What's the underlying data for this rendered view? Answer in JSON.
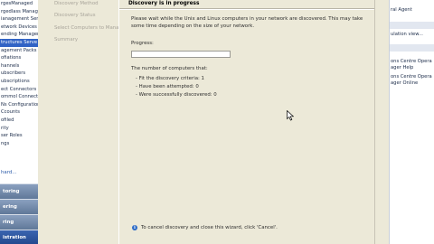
{
  "nav": {
    "items": [
      "rgesManaged",
      "rgedlass Manager",
      "ianagement Ser",
      "etwork Devices",
      "ending Manager",
      "tructures Serve",
      "agement Packs",
      "ofiations",
      "hannels",
      "ubscribers",
      "ubscriptions",
      "ect Connectors",
      "ommol Connect",
      "Ns Configuration",
      "Ccounts",
      "ofiled",
      "rity",
      "ser Roles",
      "ngs"
    ],
    "link": "hard...",
    "workspace_buttons": [
      "toring",
      "ering",
      "ring",
      "istration"
    ]
  },
  "wizard": {
    "steps": [
      "Discovery Method",
      "Discovery Status",
      "Select Computers to Manage",
      "Summary"
    ],
    "title": "Discovery is in progress",
    "description": "Please wait while the Unix and Linux computers in your network are discovered. This may take some time depending on the size of your network.",
    "progress_label": "Progress:",
    "progress_value": 0,
    "count_label": "The number of computers that:",
    "count_lines": [
      "- Fit the discovery criteria: 1",
      "- Have been attempted: 0",
      "- Were successfully discovered: 0"
    ],
    "info_text": "To cancel discovery and close this wizard, click 'Cancel'."
  },
  "actions": {
    "items": [
      "ral Agent",
      "ulation view...",
      "ons Centre Opera",
      "ager Help",
      "ons Centre Opera",
      "ager Online"
    ]
  },
  "colors": {
    "wizard_bg": "#ece9d8",
    "progress_fill": "#3a8a2b",
    "workspace_btn": "#6f86a6"
  }
}
